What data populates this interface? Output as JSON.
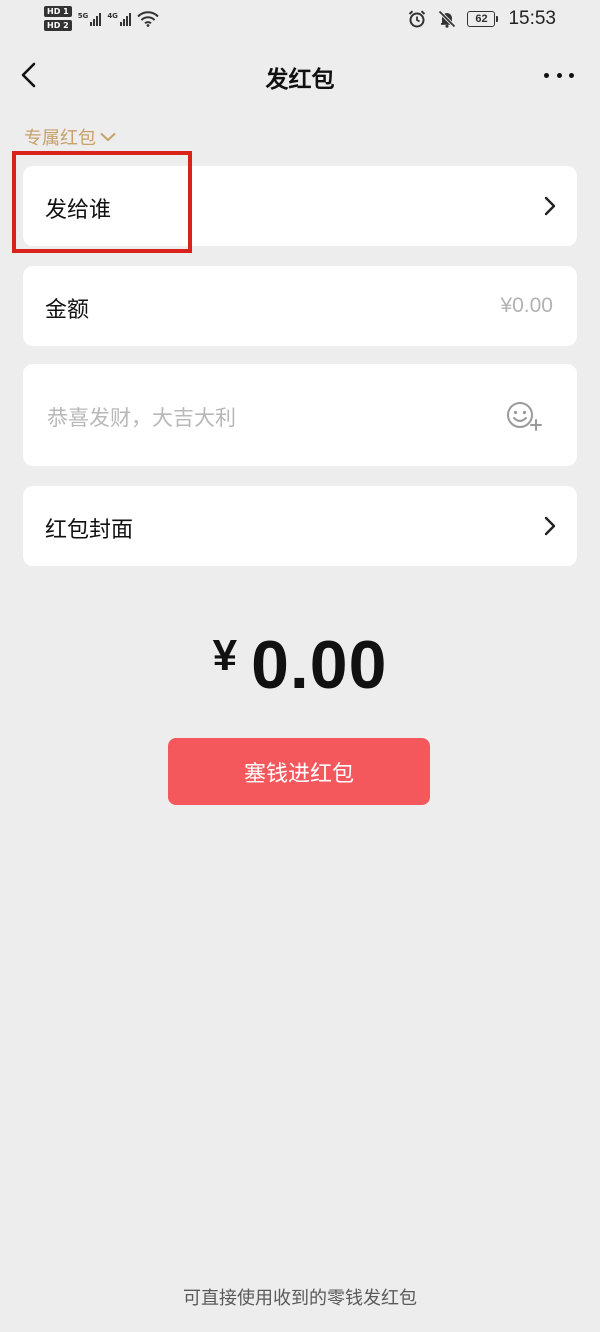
{
  "status_bar": {
    "hd_badges": [
      "HD 1",
      "HD 2"
    ],
    "signal_tags": [
      "5G",
      "4G"
    ],
    "battery": "62",
    "time": "15:53"
  },
  "nav": {
    "title": "发红包"
  },
  "packet_type": {
    "label": "专属红包"
  },
  "form": {
    "recipient_label": "发给谁",
    "amount_label": "金额",
    "amount_placeholder": "¥0.00",
    "greeting_placeholder": "恭喜发财，大吉大利",
    "cover_label": "红包封面"
  },
  "total": {
    "currency": "¥",
    "value": "0.00"
  },
  "submit": {
    "label": "塞钱进红包"
  },
  "footer": {
    "note": "可直接使用收到的零钱发红包"
  },
  "colors": {
    "accent": "#f5585c",
    "packet_type": "#c7a06a",
    "highlight": "#d9221c",
    "background": "#ededed"
  }
}
